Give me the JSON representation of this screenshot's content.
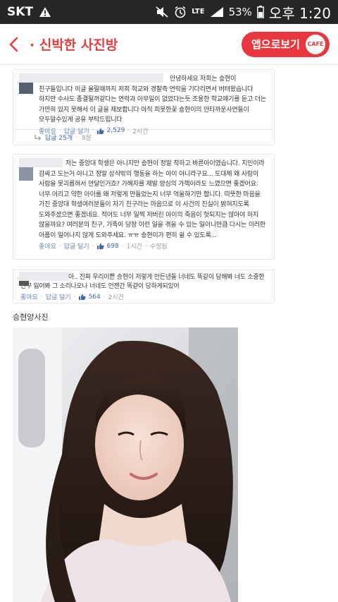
{
  "status_bar": {
    "carrier": "SKT",
    "network": "LTE",
    "battery": "53%",
    "time": "오후 1:20"
  },
  "header": {
    "title": "· 신박한 사진방",
    "app_button_label": "앱으로보기",
    "cafe_badge": "CAFE"
  },
  "comments": [
    {
      "text": "안녕하세요 저희는 승현이 친구들입니다 이글 올릴때까지 저희 학교와 경찰측 연락을 기다리면서 버텨왔습니다 하지만 수사도 종결될꺼같다는 연락과 아무일이 없었다는듯 조용한 학교얘기를 듣고 더는 가만히 있지 못해서 이 글을 제보합니다 아직 피못한꽃 승현이의 안타까운사연들이 모두알수있게 공유 부탁드립니다",
      "like_label": "좋아요",
      "reply_label": "답글 달기",
      "likes": "2,529",
      "time": "2시간",
      "replies_label": "답글 25개",
      "replies_time": "8분"
    },
    {
      "text": "저는 중앙대 학생은 아니지만 승현이 정말 착하고 바른아이였습니다. 지인이라 감싸고 도는거 아니고 정말 상식밖의 행동을 하는 아이 아니라구요... 도대체 왜 사람이 사람을 못괴롭혀서 안달인거죠? 가해자를 제발 양심의 가책이라도 느꼈으면 좋겠어요. 너무 어리고 약한 아이를 왜 저렇게 만들었는지 너무 억울하기만 합니다. 따뜻한 마음을 가진 중앙대 학생여러분들이 자기 친구라는 마음으로 이 사건의 진실이 밝혀지도록 도와주셨으면 좋겠네요. 적어도 너무 일찍 저버린 아이의 죽음이 헛되지는 않아야 하지 않을까요? 여러분의 친구, 가족이 당장 이런 일을 겪을 수 있는 일이니만큼 다시는 이러한 아픔이 일어나지 않게 도와주세요. ㅠㅠ 승현이가 편히 쉴 수 있도록...",
      "like_label": "좋아요",
      "reply_label": "답글 달기",
      "likes": "698",
      "time": "1시간",
      "edited_label": "수정됨"
    },
    {
      "text": "아.. 진짜 우리이쁜 승현이 저렇게 만든년들 너네도 똑같이 당해봐 너도 소중한 친구 잃어봐 그 소리나오나 너네도 언젠간 똑같이 당하게되있어",
      "like_label": "좋아요",
      "reply_label": "답글 달기",
      "likes": "564",
      "time": "2시간"
    }
  ],
  "photo_caption": "승현양사진",
  "colors": {
    "brand_red": "#e8383d",
    "link_blue": "#4267b2",
    "status_bar": "#262626"
  }
}
